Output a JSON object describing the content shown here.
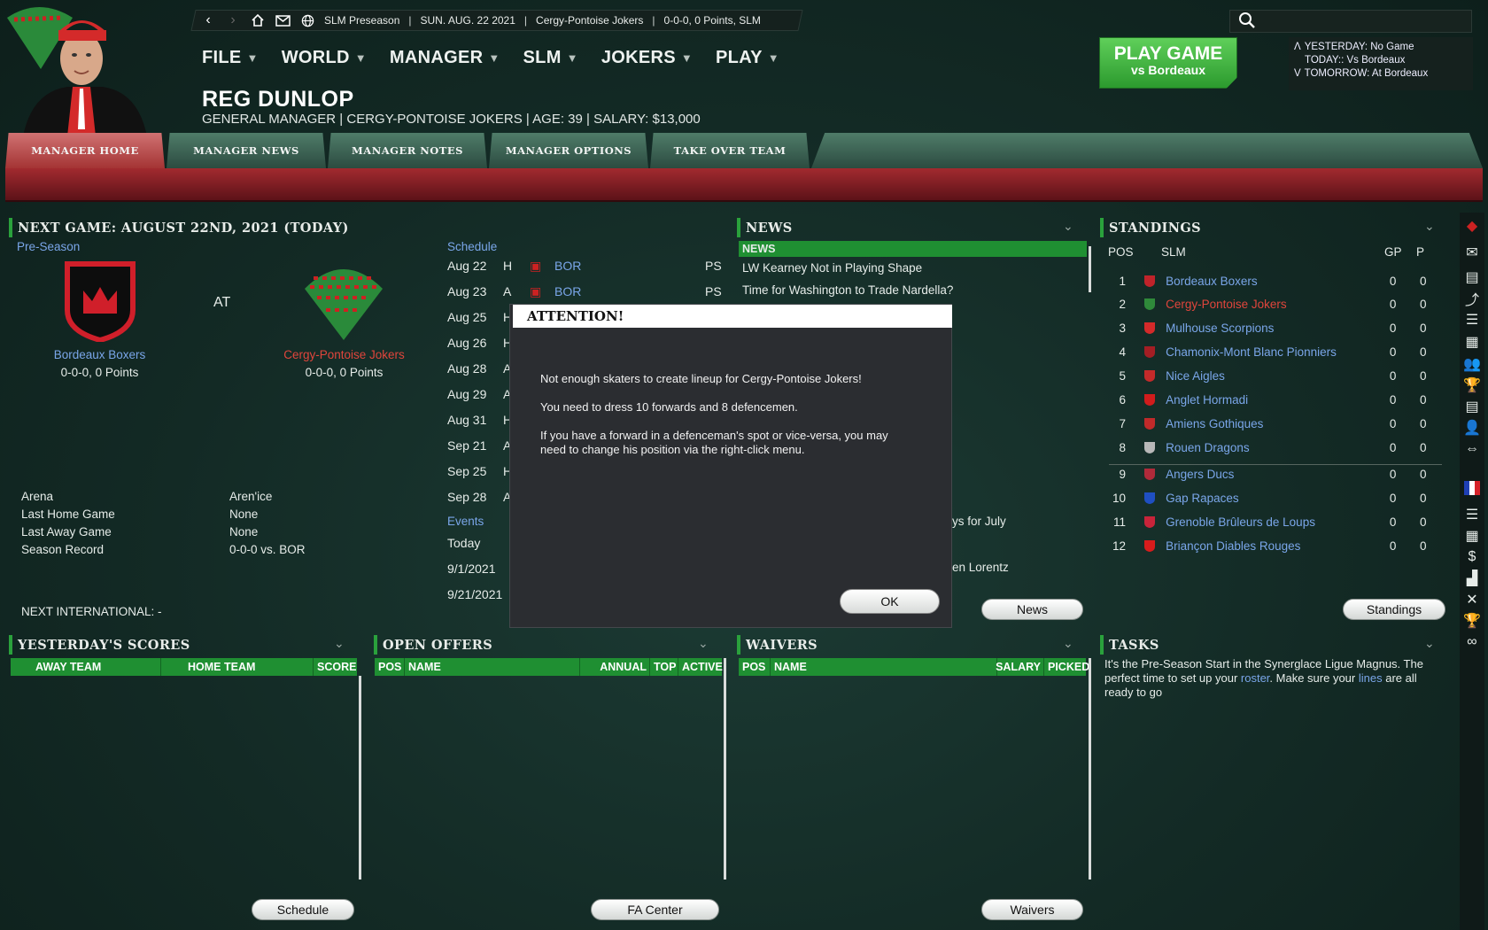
{
  "topbar": {
    "league": "SLM Preseason",
    "date": "SUN. AUG. 22 2021",
    "team": "Cergy-Pontoise Jokers",
    "record": "0-0-0, 0 Points, SLM"
  },
  "menu": [
    "FILE",
    "WORLD",
    "MANAGER",
    "SLM",
    "JOKERS",
    "PLAY"
  ],
  "manager": {
    "name": "REG DUNLOP",
    "subtitle": "GENERAL MANAGER | CERGY-PONTOISE JOKERS | AGE: 39 | SALARY: $13,000"
  },
  "play_button": {
    "main": "PLAY GAME",
    "sub": "vs Bordeaux"
  },
  "schedule_mini": {
    "yesterday": "YESTERDAY: No Game",
    "today": "TODAY:: Vs Bordeaux",
    "tomorrow": "TOMORROW: At Bordeaux"
  },
  "tabs": [
    "MANAGER HOME",
    "MANAGER NEWS",
    "MANAGER NOTES",
    "MANAGER OPTIONS",
    "TAKE OVER TEAM"
  ],
  "next_game": {
    "header": "NEXT GAME: AUGUST 22ND, 2021 (TODAY)",
    "type": "Pre-Season",
    "at": "AT",
    "away": {
      "name": "Bordeaux Boxers",
      "record": "0-0-0, 0 Points"
    },
    "home": {
      "name": "Cergy-Pontoise Jokers",
      "record": "0-0-0, 0 Points"
    },
    "info_labels": [
      "Arena",
      "Last Home Game",
      "Last Away Game",
      "Season Record"
    ],
    "info_values": [
      "Aren'ice",
      "None",
      "None",
      "0-0-0 vs. BOR"
    ],
    "international": "NEXT INTERNATIONAL: -"
  },
  "schedule": {
    "title": "Schedule",
    "rows": [
      {
        "date": "Aug 22",
        "ha": "H",
        "opp": "BOR",
        "type": "PS"
      },
      {
        "date": "Aug 23",
        "ha": "A",
        "opp": "BOR",
        "type": "PS"
      },
      {
        "date": "Aug 25",
        "ha": "H"
      },
      {
        "date": "Aug 26",
        "ha": "H"
      },
      {
        "date": "Aug 28",
        "ha": "A"
      },
      {
        "date": "Aug 29",
        "ha": "A"
      },
      {
        "date": "Aug 31",
        "ha": "H"
      },
      {
        "date": "Sep 21",
        "ha": "A"
      },
      {
        "date": "Sep 25",
        "ha": "H"
      },
      {
        "date": "Sep 28",
        "ha": "A"
      }
    ],
    "events_title": "Events",
    "events": [
      "Today",
      "9/1/2021",
      "9/21/2021"
    ]
  },
  "news": {
    "header": "NEWS",
    "tab": "NEWS",
    "items": [
      "LW Kearney Not in Playing Shape",
      "Time for Washington to Trade Nardella?"
    ],
    "partial1": "ys for July",
    "partial2": "en Lorentz",
    "button": "News"
  },
  "standings": {
    "header": "STANDINGS",
    "col_pos": "POS",
    "col_league": "SLM",
    "col_gp": "GP",
    "col_p": "P",
    "rows": [
      {
        "pos": "1",
        "team": "Bordeaux Boxers",
        "gp": "0",
        "p": "0",
        "color": "#c0232a"
      },
      {
        "pos": "2",
        "team": "Cergy-Pontoise Jokers",
        "gp": "0",
        "p": "0",
        "color": "#2f8a3a"
      },
      {
        "pos": "3",
        "team": "Mulhouse Scorpions",
        "gp": "0",
        "p": "0",
        "color": "#d42a2a"
      },
      {
        "pos": "4",
        "team": "Chamonix-Mont Blanc Pionniers",
        "gp": "0",
        "p": "0",
        "color": "#a41e24"
      },
      {
        "pos": "5",
        "team": "Nice Aigles",
        "gp": "0",
        "p": "0",
        "color": "#c42a2a"
      },
      {
        "pos": "6",
        "team": "Anglet Hormadi",
        "gp": "0",
        "p": "0",
        "color": "#d11c1c"
      },
      {
        "pos": "7",
        "team": "Amiens Gothiques",
        "gp": "0",
        "p": "0",
        "color": "#c02a2a"
      },
      {
        "pos": "8",
        "team": "Rouen Dragons",
        "gp": "0",
        "p": "0",
        "color": "#b8b8b8"
      },
      {
        "pos": "9",
        "team": "Angers Ducs",
        "gp": "0",
        "p": "0",
        "color": "#b02a3a"
      },
      {
        "pos": "10",
        "team": "Gap Rapaces",
        "gp": "0",
        "p": "0",
        "color": "#1f4fc2"
      },
      {
        "pos": "11",
        "team": "Grenoble Brûleurs de Loups",
        "gp": "0",
        "p": "0",
        "color": "#c8243a"
      },
      {
        "pos": "12",
        "team": "Briançon Diables Rouges",
        "gp": "0",
        "p": "0",
        "color": "#d81c1c"
      }
    ],
    "button": "Standings"
  },
  "scores": {
    "header": "YESTERDAY'S SCORES",
    "cols": [
      "AWAY TEAM",
      "HOME TEAM",
      "SCORE"
    ],
    "button": "Schedule"
  },
  "offers": {
    "header": "OPEN OFFERS",
    "cols": [
      "POS",
      "NAME",
      "ANNUAL",
      "TOP",
      "ACTIVE"
    ],
    "button": "FA Center"
  },
  "waivers": {
    "header": "WAIVERS",
    "cols": [
      "POS",
      "NAME",
      "SALARY",
      "PICKED"
    ],
    "button": "Waivers"
  },
  "tasks": {
    "header": "TASKS",
    "text_before": "It's the Pre-Season Start in the Synerglace Ligue Magnus. The perfect time to set up your ",
    "link1": "roster",
    "text_mid": ". Make sure your ",
    "link2": "lines",
    "text_after": " are all ready to go"
  },
  "modal": {
    "title": "ATTENTION!",
    "line1": "Not enough skaters to create lineup for Cergy-Pontoise Jokers!",
    "line2": "You need to dress 10 forwards and 8 defencemen.",
    "line3": "If you have a forward in a defenceman's spot or vice-versa, you may need to change his position via the right-click menu.",
    "ok": "OK"
  },
  "colors": {
    "accent_green": "#2aa13c",
    "team_red": "#e0453c",
    "link_blue": "#7aa6e9",
    "banner_red": "#a22a2f"
  }
}
